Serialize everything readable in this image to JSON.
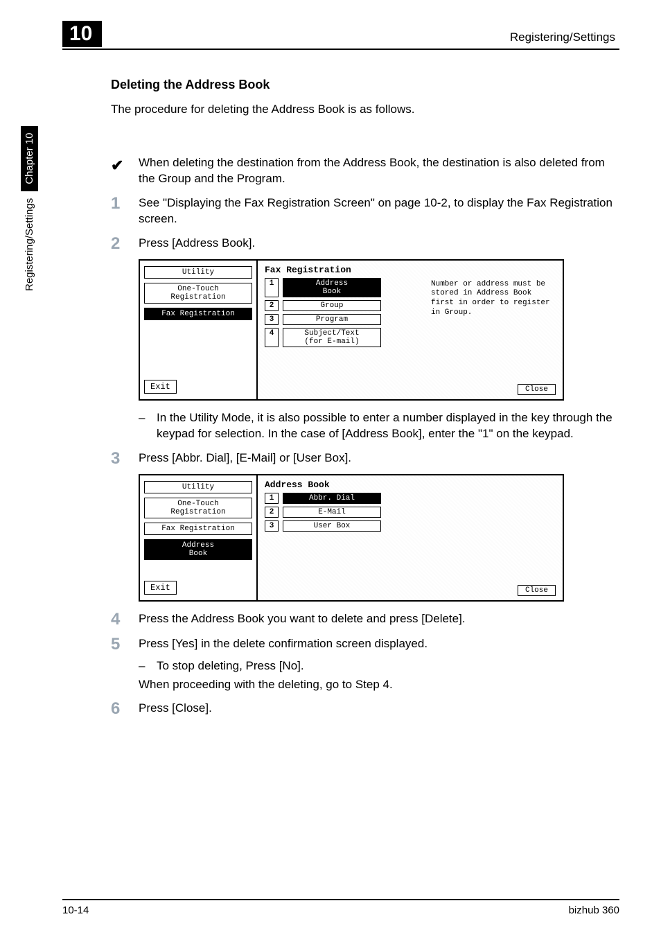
{
  "header": {
    "chapter_number": "10",
    "header_right": "Registering/Settings"
  },
  "side_tab": {
    "label_left": "Registering/Settings",
    "label_right": "Chapter 10"
  },
  "content": {
    "sub_heading": "Deleting the Address Book",
    "intro": "The procedure for deleting the Address Book is as follows.",
    "check_note": "When deleting the destination from the Address Book, the destination is also deleted from the Group and the Program.",
    "step1_num": "1",
    "step1": "See \"Displaying the Fax Registration Screen\" on page 10-2, to display the Fax Registration screen.",
    "step2_num": "2",
    "step2": "Press [Address Book].",
    "panel1": {
      "left_tabs": [
        "Utility",
        "One-Touch\nRegistration",
        "Fax Registration"
      ],
      "left_active_index": 2,
      "exit": "Exit",
      "title": "Fax Registration",
      "rows": [
        {
          "num": "1",
          "label": "Address\nBook",
          "active": true
        },
        {
          "num": "2",
          "label": "Group",
          "active": false
        },
        {
          "num": "3",
          "label": "Program",
          "active": false
        },
        {
          "num": "4",
          "label": "Subject/Text\n(for E-mail)",
          "active": false
        }
      ],
      "help": "Number or address must be stored in Address Book first in order to register in Group.",
      "close": "Close"
    },
    "step2_sub": "In the Utility Mode, it is also possible to enter a number displayed in the key through the keypad for selection. In the case of [Address Book], enter the \"1\" on the keypad.",
    "step3_num": "3",
    "step3": "Press [Abbr. Dial], [E-Mail] or [User Box].",
    "panel2": {
      "left_tabs": [
        "Utility",
        "One-Touch\nRegistration",
        "Fax Registration",
        "Address\nBook"
      ],
      "left_active_index": 3,
      "exit": "Exit",
      "title": "Address Book",
      "rows": [
        {
          "num": "1",
          "label": "Abbr. Dial",
          "active": true
        },
        {
          "num": "2",
          "label": "E-Mail",
          "active": false
        },
        {
          "num": "3",
          "label": "User Box",
          "active": false
        }
      ],
      "close": "Close"
    },
    "step4_num": "4",
    "step4": "Press the Address Book you want to delete and press [Delete].",
    "step5_num": "5",
    "step5": "Press [Yes] in the delete confirmation screen displayed.",
    "step5_sub": "To stop deleting, Press [No].",
    "step5_cont": "When proceeding with the deleting, go to Step 4.",
    "step6_num": "6",
    "step6": "Press [Close]."
  },
  "footer": {
    "left": "10-14",
    "right": "bizhub 360"
  }
}
